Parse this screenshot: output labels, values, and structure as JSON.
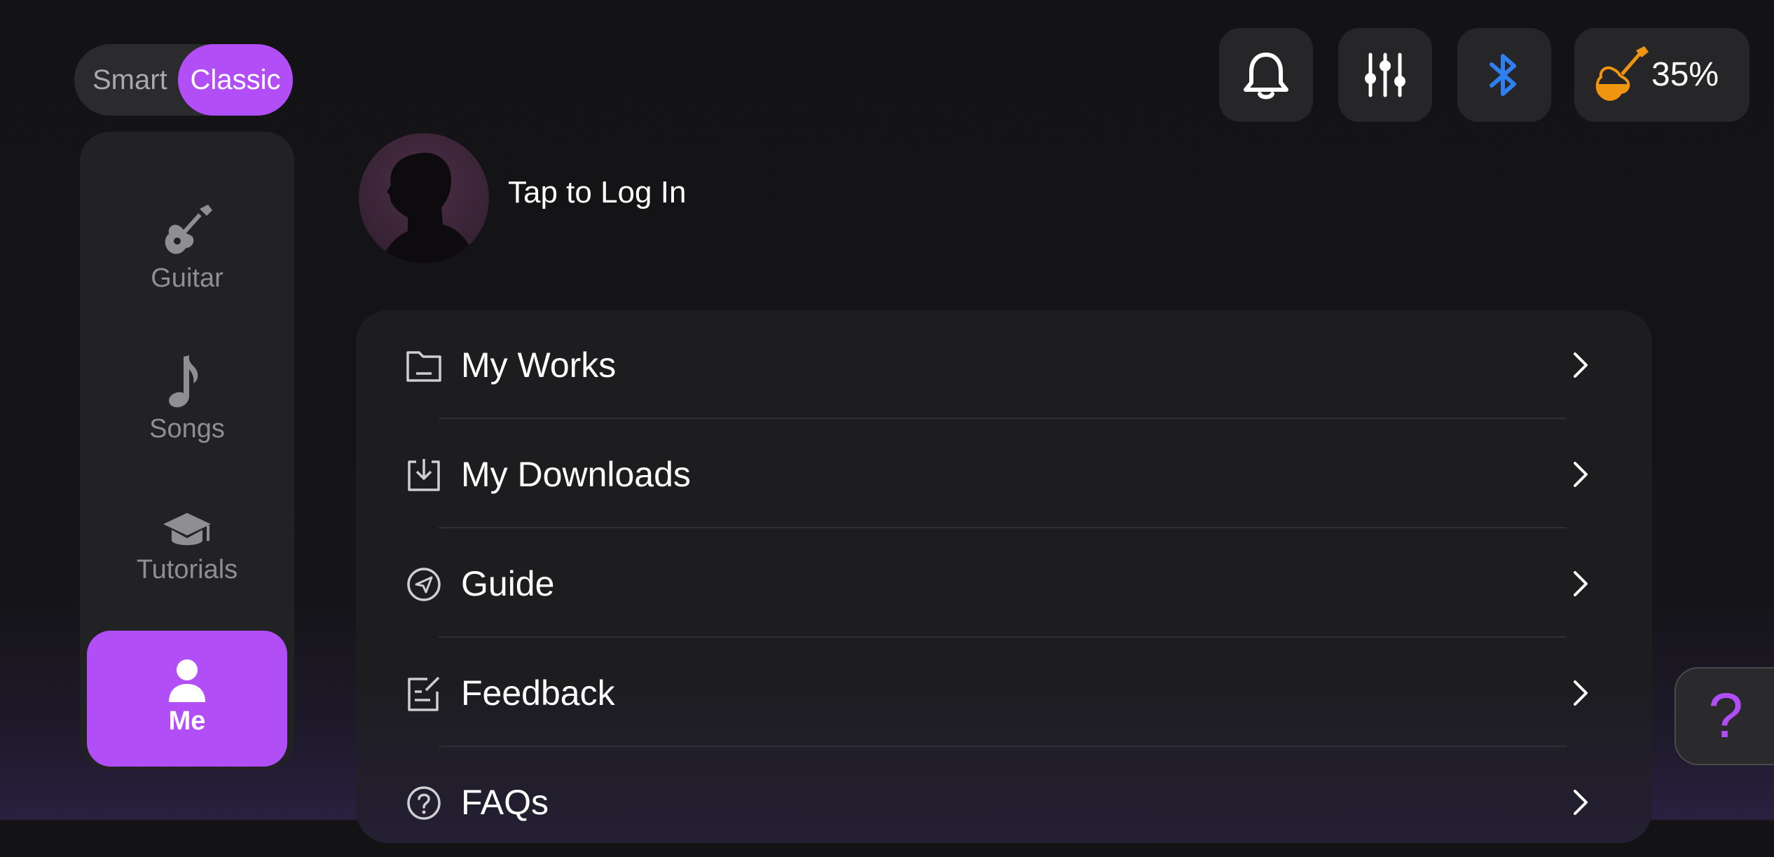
{
  "mode": {
    "smart": "Smart",
    "classic": "Classic",
    "selected": "Classic"
  },
  "sidebar": {
    "items": [
      {
        "label": "Guitar",
        "icon": "guitar-icon"
      },
      {
        "label": "Songs",
        "icon": "music-note-icon"
      },
      {
        "label": "Tutorials",
        "icon": "graduation-cap-icon"
      },
      {
        "label": "Me",
        "icon": "person-icon",
        "active": true
      }
    ]
  },
  "topbar": {
    "bell_icon": "bell-icon",
    "mixer_icon": "mixer-icon",
    "bluetooth_icon": "bluetooth-icon",
    "battery": "35%",
    "battery_level": 0.35
  },
  "profile": {
    "login": "Tap to Log In"
  },
  "menu": {
    "items": [
      {
        "label": "My Works",
        "icon": "folder-icon"
      },
      {
        "label": "My Downloads",
        "icon": "download-icon"
      },
      {
        "label": "Guide",
        "icon": "compass-icon"
      },
      {
        "label": "Feedback",
        "icon": "feedback-icon"
      },
      {
        "label": "FAQs",
        "icon": "question-circle-icon"
      }
    ]
  },
  "help": {
    "label": "?"
  },
  "colors": {
    "accent": "#b14ef5",
    "bluetooth": "#2f7ff0",
    "battery": "#f0950f",
    "background": "#131315"
  }
}
